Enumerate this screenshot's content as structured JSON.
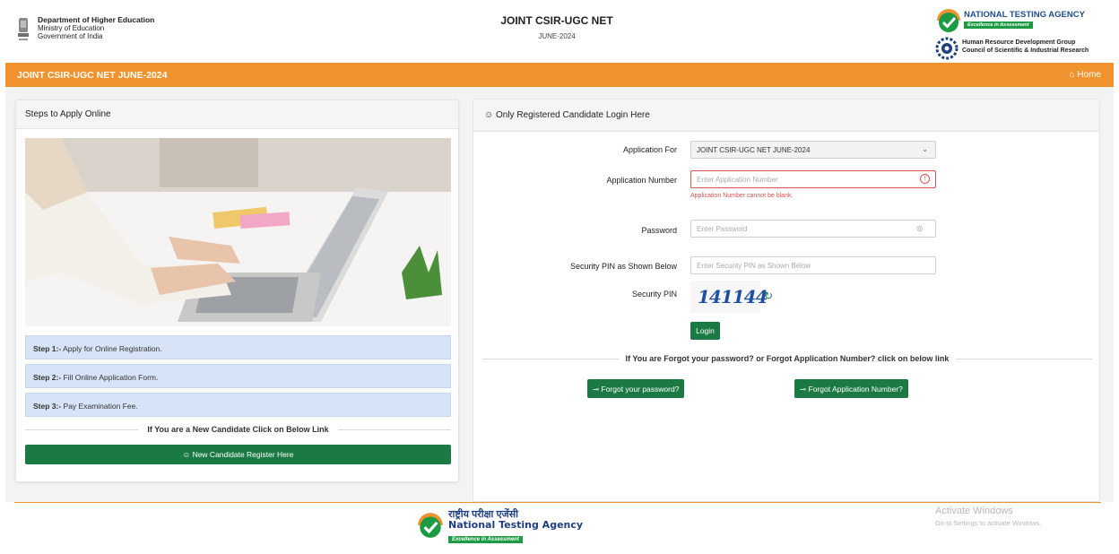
{
  "header": {
    "dept_name": "Department of Higher Education",
    "ministry": "Ministry of Education",
    "government": "Government of India",
    "exam_title": "JOINT CSIR-UGC NET",
    "session": "JUNE-2024",
    "nta_name": "NATIONAL TESTING AGENCY",
    "nta_tagline": "Excellence in Assessment",
    "csir_line1": "Human Resource Development Group",
    "csir_line2": "Council of Scientific & Industrial Research"
  },
  "navbar": {
    "exam_label": "JOINT CSIR-UGC NET JUNE-2024",
    "home_label": "Home",
    "color": "#f0932e"
  },
  "left_panel": {
    "title": "Steps to Apply Online",
    "steps": [
      {
        "label": "Step 1:-",
        "text": " Apply for Online Registration."
      },
      {
        "label": "Step 2:-",
        "text": " Fill Online Application Form."
      },
      {
        "label": "Step 3:-",
        "text": " Pay Examination Fee."
      }
    ],
    "new_candidate_text": "If You are a New Candidate Click on Below Link",
    "register_button": "New Candidate Register Here"
  },
  "login_panel": {
    "title": "Only Registered Candidate Login Here",
    "application_for_label": "Application For",
    "application_for_value": "JOINT CSIR-UGC NET JUNE-2024",
    "application_number_label": "Application Number",
    "application_number_placeholder": "Enter Application Number",
    "application_number_error": "Application Number cannot be blank.",
    "password_label": "Password",
    "password_placeholder": "Enter Password",
    "security_pin_input_label": "Security PIN as Shown Below",
    "security_pin_placeholder": "Enter Security PIN as Shown Below",
    "security_pin_label": "Security PIN",
    "captcha_value": "141144",
    "login_button": "Login",
    "forgot_text": "If You are Forgot your password? or Forgot Application Number? click on below link",
    "forgot_password_button": "Forgot your password?",
    "forgot_appno_button": "Forgot Application Number?"
  },
  "footer": {
    "hindi_name": "राष्ट्रीय परीक्षा एजेंसी",
    "english_name": "National Testing Agency",
    "tagline": "Excellence in Assessment"
  },
  "watermark": {
    "line1": "Activate Windows",
    "line2": "Go to Settings to activate Windows."
  },
  "colors": {
    "accent_green": "#1b7a43",
    "error_red": "#d9534f",
    "step_blue": "#d7e4f7"
  }
}
